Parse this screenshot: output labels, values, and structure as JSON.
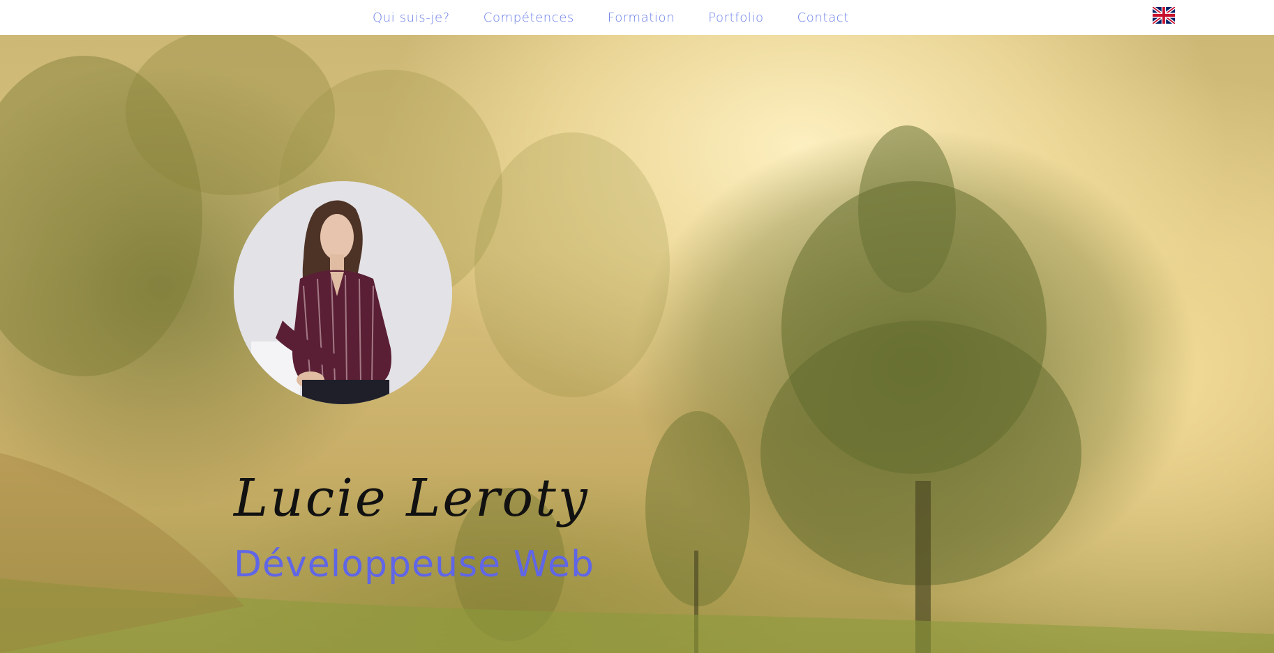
{
  "nav": {
    "links": [
      {
        "label": "Qui suis-je?"
      },
      {
        "label": "Compétences"
      },
      {
        "label": "Formation"
      },
      {
        "label": "Portfolio"
      },
      {
        "label": "Contact"
      }
    ],
    "language_flag_icon": "uk-flag-icon",
    "link_color": "#6b7fe8"
  },
  "hero": {
    "background": "misty forest",
    "name": "Lucie Leroty",
    "job_title": "Développeuse Web",
    "name_color": "#111111",
    "job_title_color": "#6066e6"
  }
}
